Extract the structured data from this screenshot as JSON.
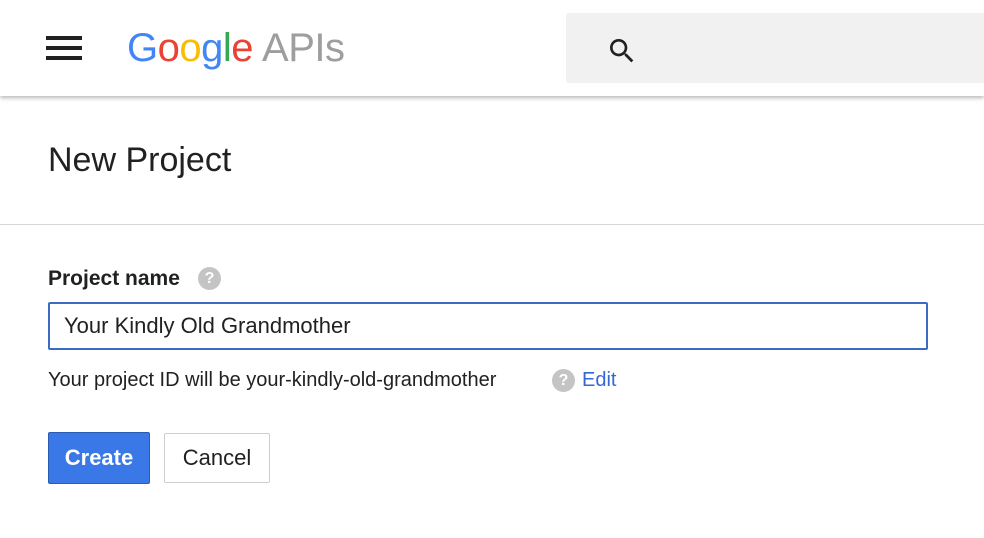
{
  "header": {
    "menu_icon": "hamburger-menu-icon",
    "logo": {
      "letters": [
        "G",
        "o",
        "o",
        "g",
        "l",
        "e"
      ],
      "suffix": "APIs",
      "colors": [
        "#4285F4",
        "#EA4335",
        "#FBBC05",
        "#4285F4",
        "#34A853",
        "#EA4335"
      ]
    },
    "search": {
      "icon": "search-icon",
      "placeholder": ""
    }
  },
  "page": {
    "title": "New Project"
  },
  "form": {
    "project_name_label": "Project name",
    "help_glyph": "?",
    "project_name_value": "Your Kindly Old Grandmother",
    "project_id_text": "Your project ID will be your-kindly-old-grandmother",
    "edit_label": "Edit"
  },
  "buttons": {
    "create_label": "Create",
    "cancel_label": "Cancel"
  },
  "colors": {
    "accent": "#3b78e7",
    "link": "#3367d6",
    "input_border": "#3b6cc2"
  }
}
